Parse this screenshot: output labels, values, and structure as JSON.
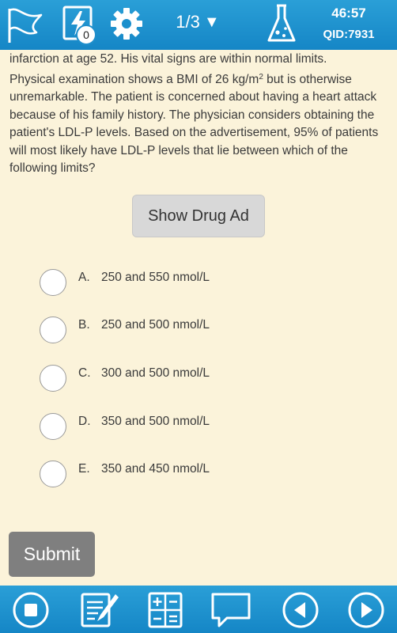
{
  "topbar": {
    "badge_count": "0",
    "pager": "1/3",
    "timer": "46:57",
    "qid": "QID:7931"
  },
  "question": {
    "line1": "infarction at age 52.  His vital signs are within normal limits.",
    "p2_before_sup": "Physical examination shows a BMI of 26 kg/m",
    "p2_sup": "2",
    "p2_after_sup": " but is otherwise unremarkable.  The patient is concerned about having a heart attack because of his family history.  The physician considers obtaining the patient's LDL-P levels.  Based on the advertisement, 95% of patients will most likely have LDL-P levels that lie between which of the following limits?"
  },
  "drug_ad_label": "Show Drug Ad",
  "options": [
    {
      "letter": "A.",
      "text": "250 and 550 nmol/L"
    },
    {
      "letter": "B.",
      "text": "250 and 500 nmol/L"
    },
    {
      "letter": "C.",
      "text": "300 and 500 nmol/L"
    },
    {
      "letter": "D.",
      "text": "350 and 500 nmol/L"
    },
    {
      "letter": "E.",
      "text": "350 and 450 nmol/L"
    }
  ],
  "submit_label": "Submit",
  "icons": {
    "top": [
      "flag-icon",
      "quick-icon",
      "gear-icon",
      "dropdown-icon",
      "flask-icon"
    ],
    "bottom": [
      "stop-icon",
      "notes-icon",
      "calculator-icon",
      "comment-icon",
      "previous-icon",
      "next-icon"
    ]
  },
  "colors": {
    "bar": "#1a8fcd",
    "background": "#fbf3da",
    "button_gray": "#7f7f7f"
  }
}
